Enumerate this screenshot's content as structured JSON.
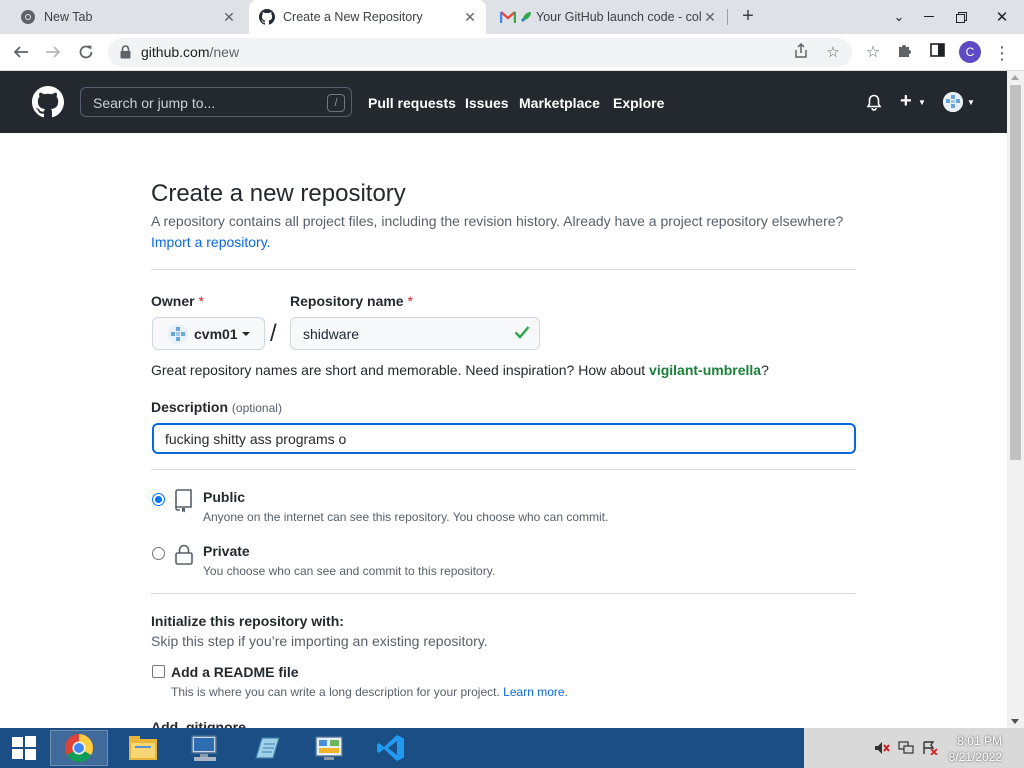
{
  "browser": {
    "tabs": [
      {
        "title": "New Tab",
        "icon": "chrome-icon",
        "active": false
      },
      {
        "title": "Create a New Repository",
        "icon": "github-icon",
        "active": true
      },
      {
        "title": "Your GitHub launch code - col",
        "icon": "gmail-icon",
        "active": false
      }
    ],
    "url_domain": "github.com",
    "url_path": "/new",
    "profile_initial": "C"
  },
  "github_header": {
    "search_placeholder": "Search or jump to...",
    "search_shortcut": "/",
    "nav": [
      "Pull requests",
      "Issues",
      "Marketplace",
      "Explore"
    ]
  },
  "page": {
    "title": "Create a new repository",
    "lead_text": "A repository contains all project files, including the revision history. Already have a project repository elsewhere?",
    "import_link": "Import a repository.",
    "owner_label": "Owner",
    "required_mark": "*",
    "owner_value": "cvm01",
    "separator": "/",
    "repo_name_label": "Repository name",
    "repo_name_value": "shidware",
    "hint_text": "Great repository names are short and memorable. Need inspiration? How about ",
    "hint_suggestion": "vigilant-umbrella",
    "hint_end": "?",
    "description_label": "Description",
    "description_optional": "(optional)",
    "description_value": "fucking shitty ass programs o",
    "visibility": [
      {
        "title": "Public",
        "desc": "Anyone on the internet can see this repository. You choose who can commit.",
        "checked": true
      },
      {
        "title": "Private",
        "desc": "You choose who can see and commit to this repository.",
        "checked": false
      }
    ],
    "init_heading": "Initialize this repository with:",
    "init_sub": "Skip this step if you’re importing an existing repository.",
    "readme_label": "Add a README file",
    "readme_desc": "This is where you can write a long description for your project.",
    "readme_link": "Learn more.",
    "next_heading": "Add .gitignore"
  },
  "taskbar": {
    "apps": [
      "chrome-icon",
      "file-explorer-icon",
      "remote-desktop-icon",
      "notepad-icon",
      "control-panel-icon",
      "vscode-icon"
    ],
    "time": "8:01 PM",
    "date": "8/21/2022"
  },
  "colors": {
    "github_header_bg": "#24292f",
    "link_blue": "#0969da",
    "success_green": "#1a7f37",
    "required_red": "#cf222e",
    "taskbar_bg": "#1c4e86"
  }
}
